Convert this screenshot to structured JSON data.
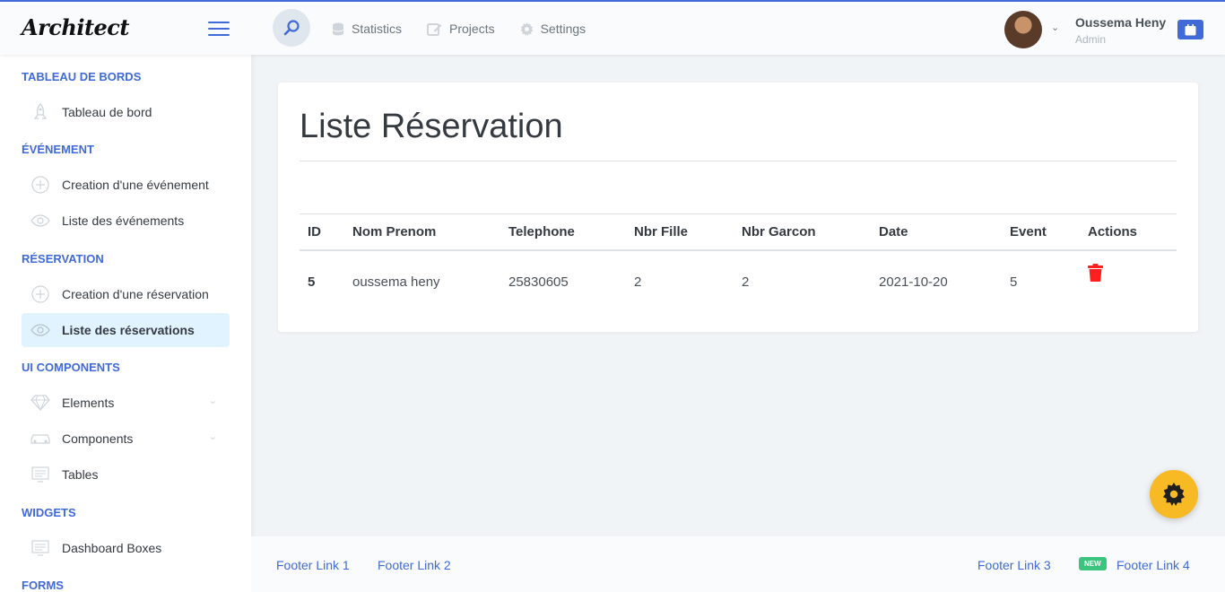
{
  "header": {
    "logo": "Architect",
    "nav": [
      {
        "label": "Statistics",
        "icon": "database-icon"
      },
      {
        "label": "Projects",
        "icon": "edit-icon"
      },
      {
        "label": "Settings",
        "icon": "gear-icon"
      }
    ],
    "user": {
      "name": "Oussema Heny",
      "role": "Admin"
    }
  },
  "sidebar": {
    "sections": [
      {
        "heading": "TABLEAU DE BORDS",
        "items": [
          {
            "label": "Tableau de bord",
            "icon": "rocket-icon"
          }
        ]
      },
      {
        "heading": "ÉVÉNEMENT",
        "items": [
          {
            "label": "Creation d'une événement",
            "icon": "plus-circle-icon"
          },
          {
            "label": "Liste des événements",
            "icon": "eye-icon"
          }
        ]
      },
      {
        "heading": "RÉSERVATION",
        "items": [
          {
            "label": "Creation d'une réservation",
            "icon": "plus-circle-icon"
          },
          {
            "label": "Liste des réservations",
            "icon": "eye-icon",
            "active": true
          }
        ]
      },
      {
        "heading": "UI COMPONENTS",
        "items": [
          {
            "label": "Elements",
            "icon": "diamond-icon"
          },
          {
            "label": "Components",
            "icon": "car-icon"
          },
          {
            "label": "Tables",
            "icon": "display-icon"
          }
        ]
      },
      {
        "heading": "WIDGETS",
        "items": [
          {
            "label": "Dashboard Boxes",
            "icon": "monitor-icon"
          }
        ]
      },
      {
        "heading": "FORMS",
        "items": []
      }
    ]
  },
  "main": {
    "title": "Liste Réservation",
    "table": {
      "columns": [
        "ID",
        "Nom Prenom",
        "Telephone",
        "Nbr Fille",
        "Nbr Garcon",
        "Date",
        "Event",
        "Actions"
      ],
      "rows": [
        [
          "5",
          "oussema heny",
          "25830605",
          "2",
          "2",
          "2021-10-20",
          "5"
        ]
      ]
    }
  },
  "footer": {
    "links": [
      "Footer Link 1",
      "Footer Link 2",
      "Footer Link 3",
      "Footer Link 4"
    ],
    "badge": "NEW"
  },
  "colors": {
    "accent": "#3f6ad8",
    "danger": "#d92550",
    "warning": "#f7b924",
    "success": "#3ac47d",
    "active_bg": "#e0f3ff"
  }
}
